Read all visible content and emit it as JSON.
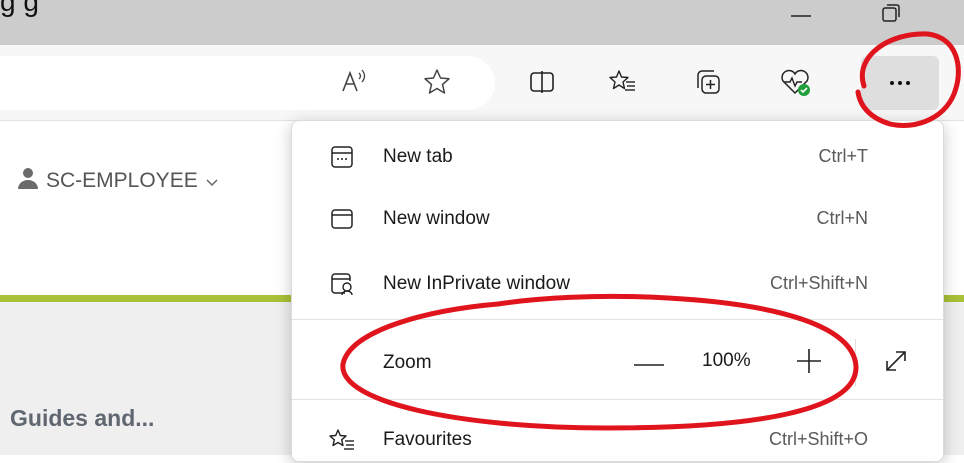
{
  "window": {
    "partial_title": "g        g",
    "minimize_icon": "minimize-icon",
    "restore_icon": "restore-icon"
  },
  "toolbar": {
    "icons": [
      "read-aloud-icon",
      "favorite-star-icon",
      "split-screen-icon",
      "favorites-icon",
      "collections-icon",
      "browser-essentials-icon",
      "more-icon"
    ],
    "more_label": "···"
  },
  "page": {
    "user_label": "SC-EMPLOYEE",
    "guides_heading": "Guides and...",
    "accent_color": "#a8c237"
  },
  "menu": {
    "items": [
      {
        "label": "New tab",
        "shortcut": "Ctrl+T",
        "icon": "new-tab-icon"
      },
      {
        "label": "New window",
        "shortcut": "Ctrl+N",
        "icon": "new-window-icon"
      },
      {
        "label": "New InPrivate window",
        "shortcut": "Ctrl+Shift+N",
        "icon": "inprivate-icon"
      }
    ],
    "zoom": {
      "label": "Zoom",
      "value": "100%",
      "icons": [
        "zoom-out-icon",
        "zoom-in-icon",
        "fullscreen-icon"
      ]
    },
    "favourites": {
      "label": "Favourites",
      "shortcut": "Ctrl+Shift+O",
      "icon": "favourites-icon"
    }
  },
  "annotations": {
    "color": "#e0141c"
  }
}
